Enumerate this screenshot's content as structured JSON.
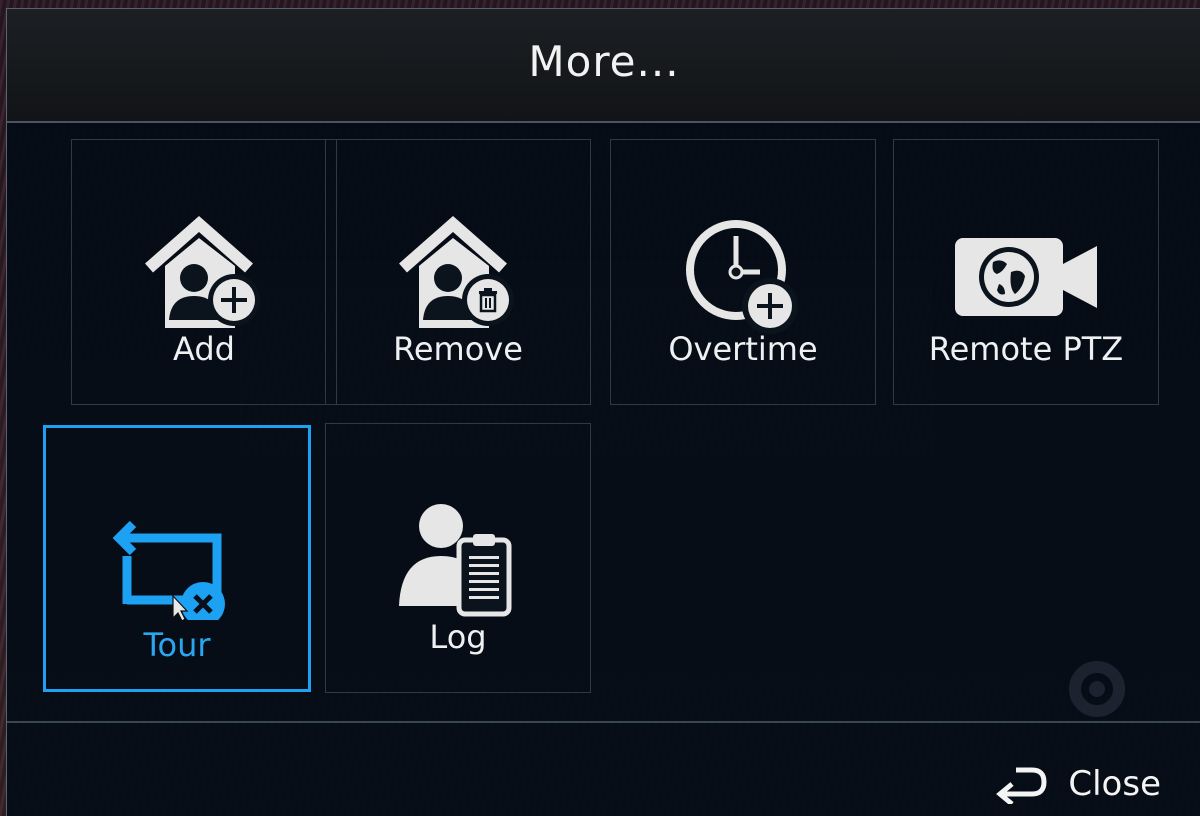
{
  "dialog": {
    "title": "More...",
    "close_label": "Close"
  },
  "tiles": [
    {
      "label": "Add",
      "icon": "home-add-user-icon",
      "selected": false
    },
    {
      "label": "Remove",
      "icon": "home-remove-user-icon",
      "selected": false
    },
    {
      "label": "Overtime",
      "icon": "clock-add-icon",
      "selected": false
    },
    {
      "label": "Remote PTZ",
      "icon": "globe-camera-icon",
      "selected": false
    },
    {
      "label": "Tour",
      "icon": "loop-cancel-icon",
      "selected": true
    },
    {
      "label": "Log",
      "icon": "user-clipboard-icon",
      "selected": false
    }
  ],
  "colors": {
    "accent": "#1da1f2",
    "panel": "#030c16",
    "text": "#eef0f2"
  }
}
